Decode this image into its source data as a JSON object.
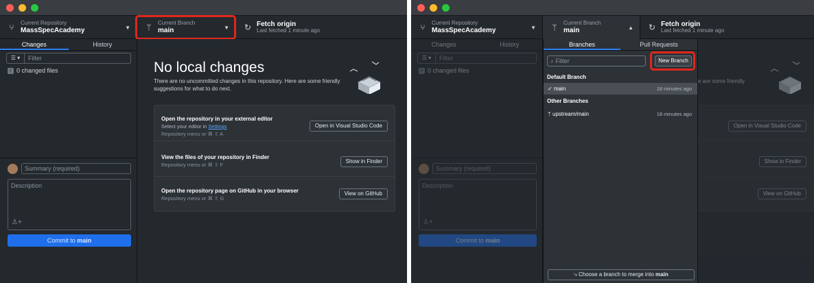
{
  "colors": {
    "accent": "#1f6feb",
    "highlight": "#e0261b",
    "bg": "#24292e"
  },
  "left": {
    "repo": {
      "label": "Current Repository",
      "value": "MassSpecAcademy"
    },
    "branch": {
      "label": "Current Branch",
      "value": "main"
    },
    "fetch": {
      "label": "Fetch origin",
      "sub": "Last fetched 1 minute ago"
    },
    "tabs": [
      "Changes",
      "History"
    ],
    "filter_placeholder": "Filter",
    "changed_files": "0 changed files",
    "summary_placeholder": "Summary (required)",
    "description_placeholder": "Description",
    "commit_prefix": "Commit to ",
    "commit_branch": "main",
    "heading": "No local changes",
    "subtext": "There are no uncommitted changes in this repository. Here are some friendly suggestions for what to do next.",
    "cards": [
      {
        "title": "Open the repository in your external editor",
        "sub_prefix": "Select your editor in ",
        "sub_link": "Settings",
        "keys": "Repository menu or ⌘ ⇧ A",
        "button": "Open in Visual Studio Code"
      },
      {
        "title": "View the files of your repository in Finder",
        "keys": "Repository menu or ⌘ ⇧ F",
        "button": "Show in Finder"
      },
      {
        "title": "Open the repository page on GitHub in your browser",
        "keys": "Repository menu or ⌘ ⇧ G",
        "button": "View on GitHub"
      }
    ]
  },
  "right": {
    "repo": {
      "label": "Current Repository",
      "value": "MassSpecAcademy"
    },
    "branch": {
      "label": "Current Branch",
      "value": "main"
    },
    "fetch": {
      "label": "Fetch origin",
      "sub": "Last fetched 1 minute ago"
    },
    "tabs": [
      "Changes",
      "History"
    ],
    "filter_placeholder": "Filter",
    "changed_files": "0 changed files",
    "summary_placeholder": "Summary (required)",
    "description_placeholder": "Description",
    "commit_prefix": "Commit to ",
    "commit_branch": "main",
    "partial_subtext": "e are some friendly",
    "buttons": [
      "Open in Visual Studio Code",
      "Show in Finder",
      "View on GitHub"
    ],
    "dropdown": {
      "tabs": [
        "Branches",
        "Pull Requests"
      ],
      "filter_placeholder": "Filter",
      "new_branch": "New Branch",
      "default_group": "Default Branch",
      "default_branch": {
        "name": "main",
        "time": "18 minutes ago"
      },
      "other_group": "Other Branches",
      "other_branch": {
        "name": "upstream/main",
        "time": "18 minutes ago"
      },
      "merge_prefix": "Choose a branch to merge into ",
      "merge_branch": "main"
    }
  }
}
